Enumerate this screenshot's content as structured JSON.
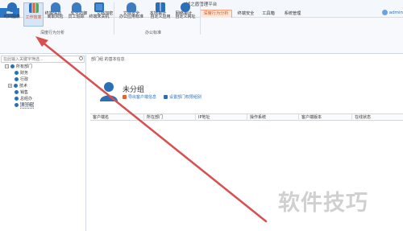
{
  "window": {
    "title": "域之盾管理平台"
  },
  "tabs": [
    {
      "label": "首页"
    },
    {
      "label": "终端信息"
    },
    {
      "label": "安全防御"
    },
    {
      "label": "文档加密"
    },
    {
      "label": "文档安全"
    },
    {
      "label": "本地审计"
    },
    {
      "label": "网络审计"
    },
    {
      "label": "深度行为分析"
    },
    {
      "label": "终端安全"
    },
    {
      "label": "工具箱"
    },
    {
      "label": "系统管理"
    }
  ],
  "user": {
    "name": "admin"
  },
  "ribbon": {
    "buttons": [
      {
        "label": "时间图像",
        "icon": "clock-icon"
      },
      {
        "label": "工作效率",
        "icon": "bar-chart-icon"
      },
      {
        "label": "离职风险",
        "icon": "person-risk-icon"
      },
      {
        "label": "员工追踪",
        "icon": "person-track-icon"
      },
      {
        "label": "终端未关机",
        "icon": "monitor-icon"
      },
      {
        "label": "办公应用标准",
        "icon": "office-person-icon"
      },
      {
        "label": "自定义应用",
        "icon": "apps-grid-icon"
      },
      {
        "label": "自定义网址",
        "icon": "globe-icon"
      }
    ],
    "groups": [
      {
        "label": "深度行为分析"
      },
      {
        "label": "办公标准"
      }
    ]
  },
  "sidebar": {
    "search_placeholder": "在此输入关键字筛选...",
    "tree": [
      {
        "label": "所有部门"
      },
      {
        "label": "财务"
      },
      {
        "label": "行政"
      },
      {
        "label": "技术"
      },
      {
        "label": "销售"
      },
      {
        "label": "总经办"
      },
      {
        "label": "未分组"
      }
    ]
  },
  "main": {
    "breadcrumb": "部门组 的基本信息",
    "group_name": "未分组",
    "links": [
      {
        "label": "导出客户端信息"
      },
      {
        "label": "设置部门权限组别"
      }
    ],
    "columns": [
      {
        "label": "客户端名"
      },
      {
        "label": "所在部门"
      },
      {
        "label": "IP地址"
      },
      {
        "label": "操作系统"
      },
      {
        "label": "客户端版本"
      },
      {
        "label": "在线状态"
      }
    ]
  },
  "watermark": "软件技巧",
  "colors": {
    "accent": "#2b6fb8",
    "active_tab": "#d4561c",
    "arrow": "#d94f4f"
  }
}
